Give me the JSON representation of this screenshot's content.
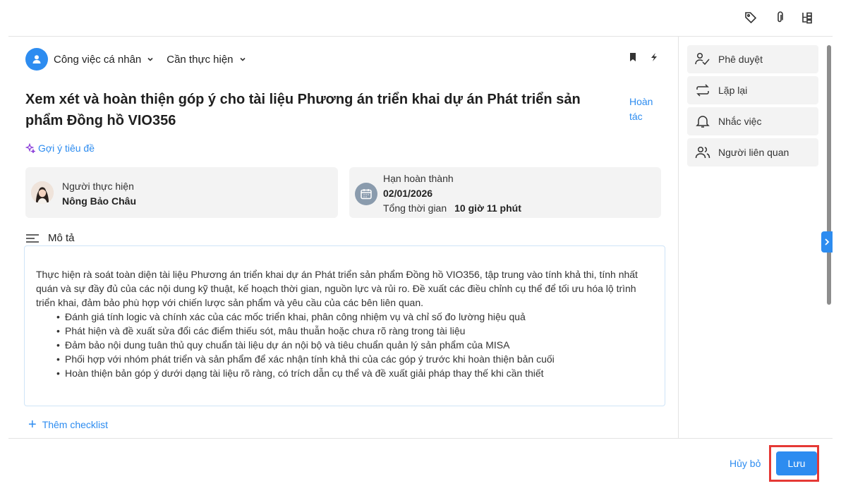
{
  "toolbar": {
    "icons": [
      "tag-icon",
      "paperclip-icon",
      "tree-structure-icon"
    ]
  },
  "header": {
    "category": "Công việc cá nhân",
    "status": "Cần thực hiện",
    "icons": [
      "bookmark-icon",
      "lightning-icon"
    ]
  },
  "task": {
    "title": "Xem xét và hoàn thiện góp ý cho tài liệu Phương án triển khai dự án Phát triển sản phẩm Đồng hồ VIO356",
    "undo_label": "Hoàn tác",
    "suggest_label": "Gợi ý tiêu đề"
  },
  "assignee": {
    "label": "Người thực hiện",
    "name": "Nông Bảo Châu"
  },
  "deadline": {
    "label": "Hạn hoàn thành",
    "date": "02/01/2026",
    "total_label": "Tổng thời gian",
    "total_value": "10 giờ 11 phút"
  },
  "description": {
    "heading": "Mô tả",
    "paragraph": "Thực hiện rà soát toàn diện tài liệu Phương án triển khai dự án Phát triển sản phẩm Đồng hồ VIO356, tập trung vào tính khả thi, tính nhất quán và sự đầy đủ của các nội dung kỹ thuật, kế hoạch thời gian, nguồn lực và rủi ro. Đề xuất các điều chỉnh cụ thể để tối ưu hóa lộ trình triển khai, đảm bảo phù hợp với chiến lược sản phẩm và yêu cầu của các bên liên quan.",
    "bullets": [
      "Đánh giá tính logic và chính xác của các mốc triển khai, phân công nhiệm vụ và chỉ số đo lường hiệu quả",
      "Phát hiện và đề xuất sửa đổi các điểm thiếu sót, mâu thuẫn hoặc chưa rõ ràng trong tài liệu",
      "Đảm bảo nội dung tuân thủ quy chuẩn tài liệu dự án nội bộ và tiêu chuẩn quản lý sản phẩm của MISA",
      "Phối hợp với nhóm phát triển và sản phẩm để xác nhận tính khả thi của các góp ý trước khi hoàn thiện bản cuối",
      "Hoàn thiện bản góp ý dưới dạng tài liệu rõ ràng, có trích dẫn cụ thể và đề xuất giải pháp thay thế khi cần thiết"
    ]
  },
  "checklist": {
    "add_label": "Thêm checklist"
  },
  "side_panel": {
    "items": [
      {
        "label": "Phê duyệt",
        "icon": "approve-icon"
      },
      {
        "label": "Lặp lại",
        "icon": "repeat-icon"
      },
      {
        "label": "Nhắc việc",
        "icon": "bell-icon"
      },
      {
        "label": "Người liên quan",
        "icon": "people-icon"
      }
    ]
  },
  "footer": {
    "cancel_label": "Hủy bỏ",
    "save_label": "Lưu"
  },
  "colors": {
    "accent": "#2d8cf0",
    "highlight_border": "#e53935",
    "card_bg": "#f3f3f3"
  }
}
